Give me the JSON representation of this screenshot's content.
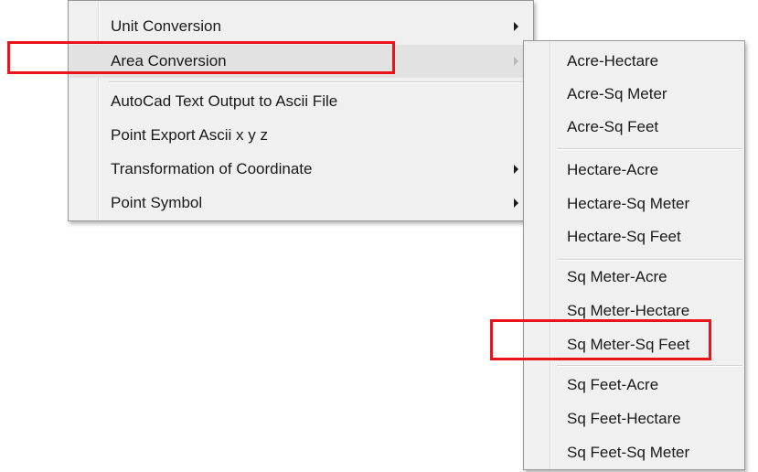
{
  "main_menu": {
    "items": [
      {
        "label": "Unit Conversion",
        "submenu": true
      },
      {
        "label": "Area Conversion",
        "submenu": true,
        "highlighted": true
      },
      {
        "label": "AutoCad Text Output to Ascii File",
        "submenu": false
      },
      {
        "label": "Point Export Ascii x y z",
        "submenu": false
      },
      {
        "label": "Transformation of Coordinate",
        "submenu": true
      },
      {
        "label": "Point Symbol",
        "submenu": true
      }
    ]
  },
  "area_submenu": {
    "items": [
      {
        "label": "Acre-Hectare"
      },
      {
        "label": "Acre-Sq Meter"
      },
      {
        "label": "Acre-Sq Feet"
      },
      {
        "label": "Hectare-Acre"
      },
      {
        "label": "Hectare-Sq Meter"
      },
      {
        "label": "Hectare-Sq Feet"
      },
      {
        "label": "Sq Meter-Acre"
      },
      {
        "label": "Sq Meter-Hectare"
      },
      {
        "label": "Sq Meter-Sq Feet"
      },
      {
        "label": "Sq Feet-Acre"
      },
      {
        "label": "Sq Feet-Hectare"
      },
      {
        "label": "Sq Feet-Sq Meter"
      }
    ]
  },
  "annotations": {
    "highlight_color": "#e8141a"
  }
}
